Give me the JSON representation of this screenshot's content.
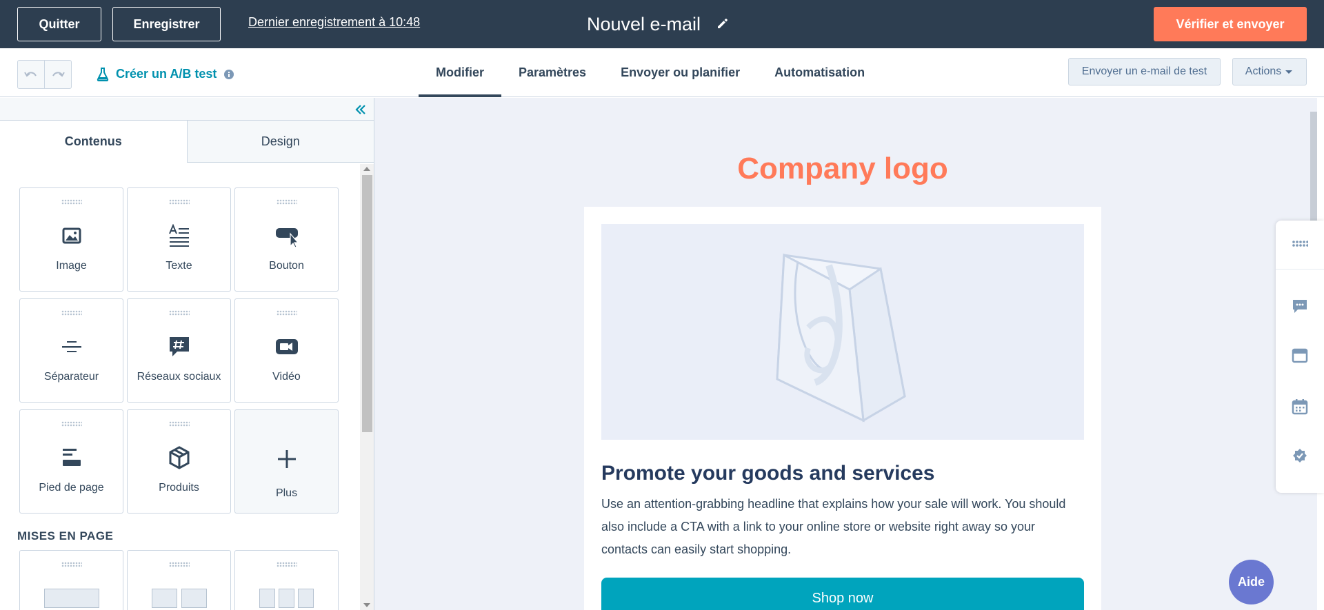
{
  "topbar": {
    "quit_label": "Quitter",
    "save_label": "Enregistrer",
    "last_saved": "Dernier enregistrement à 10:48",
    "title": "Nouvel e-mail",
    "review_send_label": "Vérifier et envoyer"
  },
  "subbar": {
    "ab_test_label": "Créer un A/B test",
    "tabs": [
      {
        "label": "Modifier",
        "active": true
      },
      {
        "label": "Paramètres",
        "active": false
      },
      {
        "label": "Envoyer ou planifier",
        "active": false
      },
      {
        "label": "Automatisation",
        "active": false
      }
    ],
    "send_test_label": "Envoyer un e-mail de test",
    "actions_label": "Actions"
  },
  "left_panel": {
    "tabs": [
      {
        "label": "Contenus",
        "active": true
      },
      {
        "label": "Design",
        "active": false
      }
    ],
    "modules": [
      {
        "label": "Image",
        "icon": "image-icon"
      },
      {
        "label": "Texte",
        "icon": "text-icon"
      },
      {
        "label": "Bouton",
        "icon": "button-icon"
      },
      {
        "label": "Séparateur",
        "icon": "divider-icon"
      },
      {
        "label": "Réseaux sociaux",
        "icon": "social-icon"
      },
      {
        "label": "Vidéo",
        "icon": "video-icon"
      },
      {
        "label": "Pied de page",
        "icon": "footer-icon"
      },
      {
        "label": "Produits",
        "icon": "products-icon"
      },
      {
        "label": "Plus",
        "icon": "plus-icon"
      }
    ],
    "layouts_heading": "MISES EN PAGE"
  },
  "email": {
    "logo_text": "Company logo",
    "heading": "Promote your goods and services",
    "body": "Use an attention-grabbing headline that explains how your sale will work. You should also include a CTA with a link to your online store or website right away so your contacts can easily start shopping.",
    "cta_label": "Shop now"
  },
  "help_label": "Aide",
  "colors": {
    "topbar_bg": "#2d3e50",
    "primary": "#ff7a59",
    "link": "#0091ae",
    "cta": "#00a4bd",
    "help": "#6a78d1"
  }
}
